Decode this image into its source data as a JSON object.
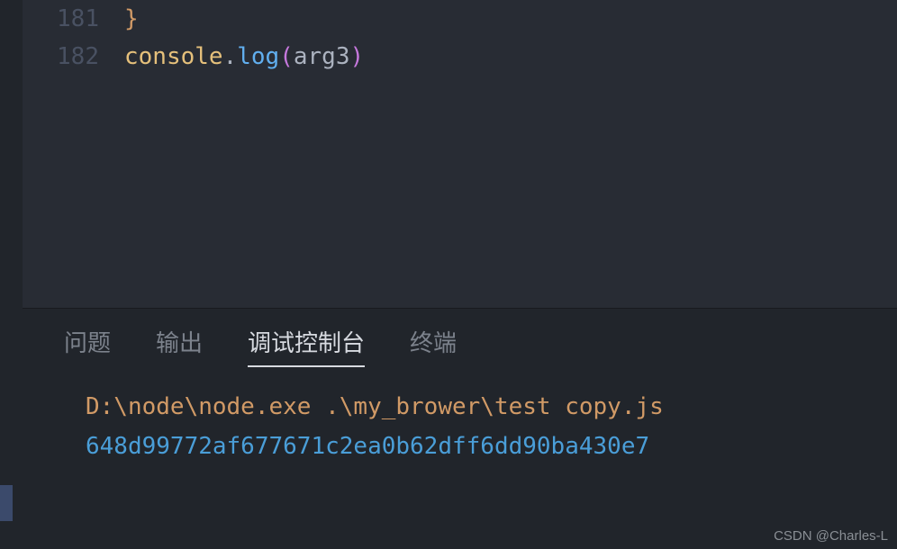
{
  "editor": {
    "lines": [
      {
        "number": "181",
        "tokens": [
          {
            "cls": "brace",
            "text": "}"
          }
        ]
      },
      {
        "number": "182",
        "tokens": [
          {
            "cls": "object",
            "text": "console"
          },
          {
            "cls": "dot",
            "text": "."
          },
          {
            "cls": "method",
            "text": "log"
          },
          {
            "cls": "paren-open",
            "text": "("
          },
          {
            "cls": "arg",
            "text": "arg3"
          },
          {
            "cls": "paren-close",
            "text": ")"
          }
        ]
      }
    ]
  },
  "panel": {
    "tabs": [
      {
        "label": "问题",
        "active": false,
        "name": "tab-problems"
      },
      {
        "label": "输出",
        "active": false,
        "name": "tab-output"
      },
      {
        "label": "调试控制台",
        "active": true,
        "name": "tab-debug-console"
      },
      {
        "label": "终端",
        "active": false,
        "name": "tab-terminal"
      }
    ],
    "console": {
      "command": "D:\\node\\node.exe .\\my_brower\\test copy.js",
      "output": "648d99772af677671c2ea0b62dff6dd90ba430e7"
    }
  },
  "watermark": "CSDN @Charles-L"
}
